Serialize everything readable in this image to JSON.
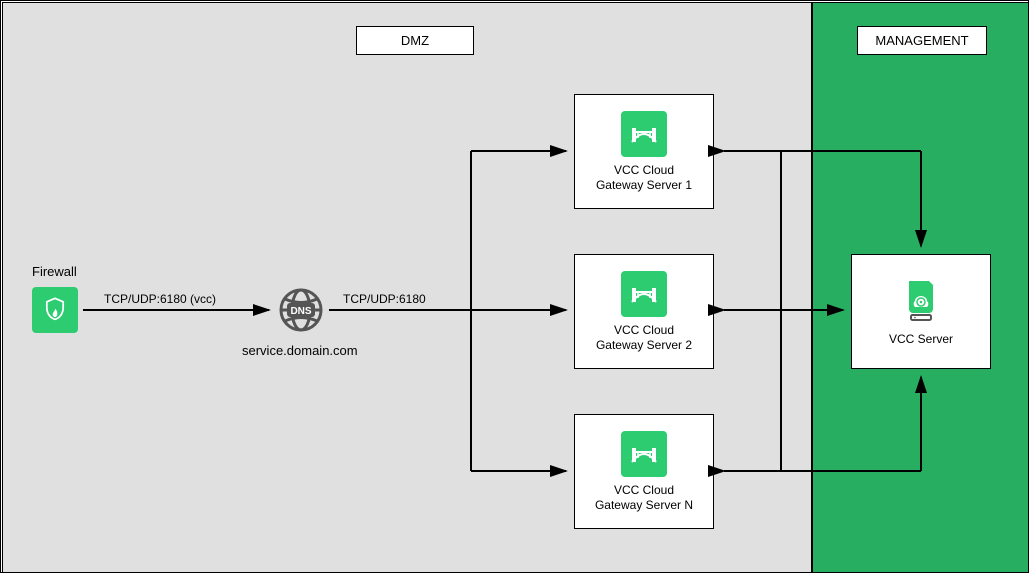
{
  "zones": {
    "dmz": {
      "label": "DMZ"
    },
    "management": {
      "label": "MANAGEMENT"
    }
  },
  "nodes": {
    "firewall": {
      "label": "Firewall"
    },
    "dns": {
      "label": "service.domain.com"
    },
    "gateway1": {
      "label1": "VCC Cloud",
      "label2": "Gateway Server 1"
    },
    "gateway2": {
      "label1": "VCC Cloud",
      "label2": "Gateway Server 2"
    },
    "gatewayN": {
      "label1": "VCC Cloud",
      "label2": "Gateway Server N"
    },
    "vcc": {
      "label": "VCC Server"
    }
  },
  "edges": {
    "fw_dns": {
      "label": "TCP/UDP:6180 (vcc)"
    },
    "dns_gw": {
      "label": "TCP/UDP:6180"
    }
  },
  "colors": {
    "green": "#2ecc71",
    "zoneGreen": "#27ae60",
    "grey": "#e0e0e0",
    "text": "#000000"
  }
}
